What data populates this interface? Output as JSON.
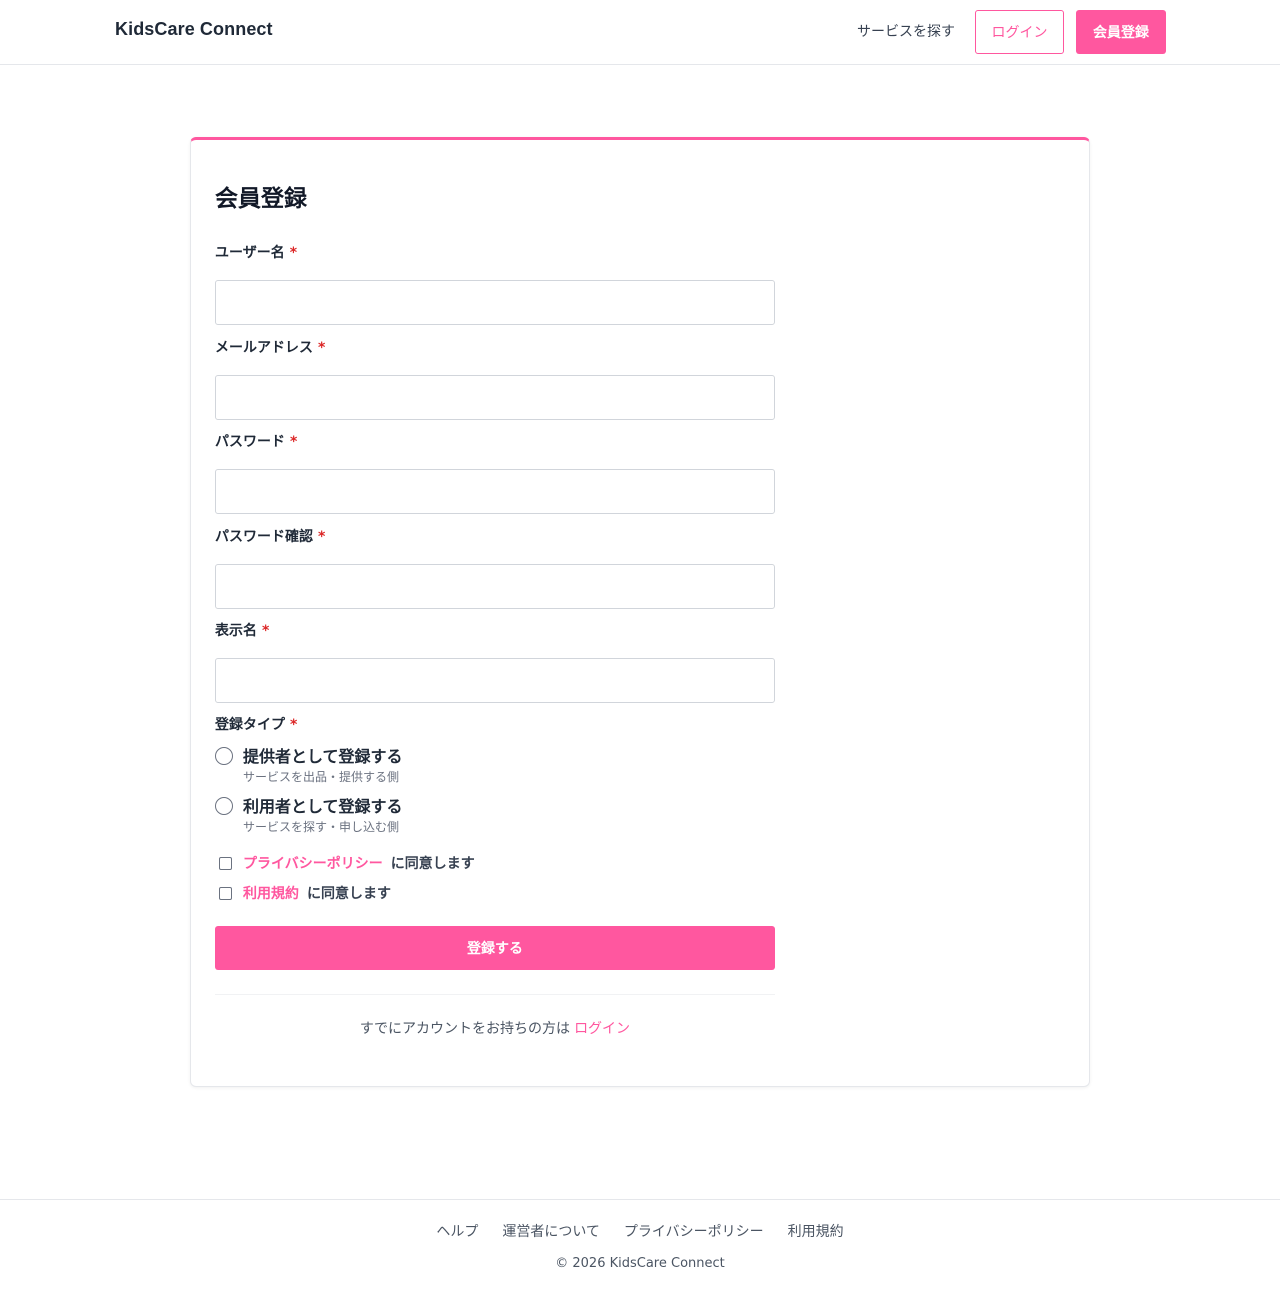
{
  "header": {
    "brand": "KidsCare Connect",
    "nav_search": "サービスを探す",
    "nav_login": "ログイン",
    "nav_register": "会員登録"
  },
  "form": {
    "title": "会員登録",
    "required_mark": "*",
    "fields": [
      {
        "label": "ユーザー名",
        "value": ""
      },
      {
        "label": "メールアドレス",
        "value": ""
      },
      {
        "label": "パスワード",
        "value": ""
      },
      {
        "label": "パスワード確認",
        "value": ""
      },
      {
        "label": "表示名",
        "value": ""
      }
    ],
    "type_label": "登録タイプ",
    "types": [
      {
        "title": "提供者として登録する",
        "sub": "サービスを出品・提供する側"
      },
      {
        "title": "利用者として登録する",
        "sub": "サービスを探す・申し込む側"
      }
    ],
    "agreements": [
      {
        "link": "プライバシーポリシー",
        "text": "に同意します"
      },
      {
        "link": "利用規約",
        "text": "に同意します"
      }
    ],
    "submit": "登録する",
    "have_account": "すでにアカウントをお持ちの方は",
    "login_link": "ログイン"
  },
  "footer": {
    "links": [
      "ヘルプ",
      "運営者について",
      "プライバシーポリシー",
      "利用規約"
    ],
    "copyright": "© 2026 KidsCare Connect"
  },
  "colors": {
    "accent": "#ff579f",
    "required": "#dc2626"
  }
}
